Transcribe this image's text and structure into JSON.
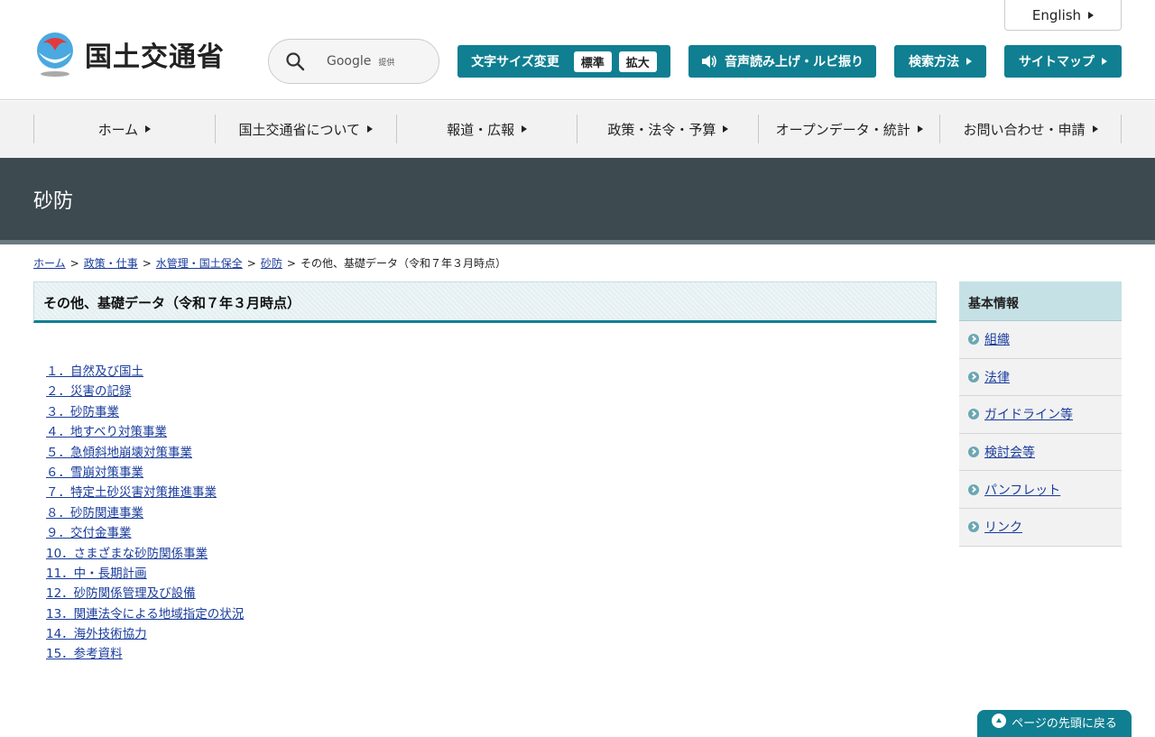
{
  "header": {
    "logo_text": "国土交通省",
    "english_label": "English",
    "search": {
      "google_label": "Google",
      "provider_label": "提供"
    },
    "font_size": {
      "label": "文字サイズ変更",
      "standard": "標準",
      "large": "拡大"
    },
    "voice_label": "音声読み上げ・ルビ振り",
    "search_method_label": "検索方法",
    "sitemap_label": "サイトマップ"
  },
  "gnav": {
    "items": [
      "ホーム",
      "国土交通省について",
      "報道・広報",
      "政策・法令・予算",
      "オープンデータ・統計",
      "お問い合わせ・申請"
    ]
  },
  "page_title": "砂防",
  "breadcrumb": {
    "items": [
      "ホーム",
      "政策・仕事",
      "水管理・国土保全",
      "砂防"
    ],
    "current": "その他、基礎データ（令和７年３月時点）",
    "separator": ">"
  },
  "main": {
    "heading": "その他、基礎データ（令和７年３月時点）",
    "links": [
      "１．自然及び国土",
      "２．災害の記録",
      "３．砂防事業",
      "４．地すべり対策事業",
      "５．急傾斜地崩壊対策事業",
      "６．雪崩対策事業",
      "７．特定土砂災害対策推進事業",
      "８．砂防関連事業",
      "９．交付金事業",
      "10．さまざまな砂防関係事業",
      "11．中・長期計画",
      "12．砂防関係管理及び設備",
      "13．関連法令による地域指定の状況",
      "14．海外技術協力",
      "15．参考資料"
    ]
  },
  "side": {
    "heading": "基本情報",
    "items": [
      "組織",
      "法律",
      "ガイドライン等",
      "検討会等",
      "パンフレット",
      "リンク"
    ]
  },
  "pagetop_label": "ページの先頭に戻る",
  "colors": {
    "accent": "#0f7f91",
    "title_band": "#3d4a50",
    "link": "#1a3c9c"
  }
}
